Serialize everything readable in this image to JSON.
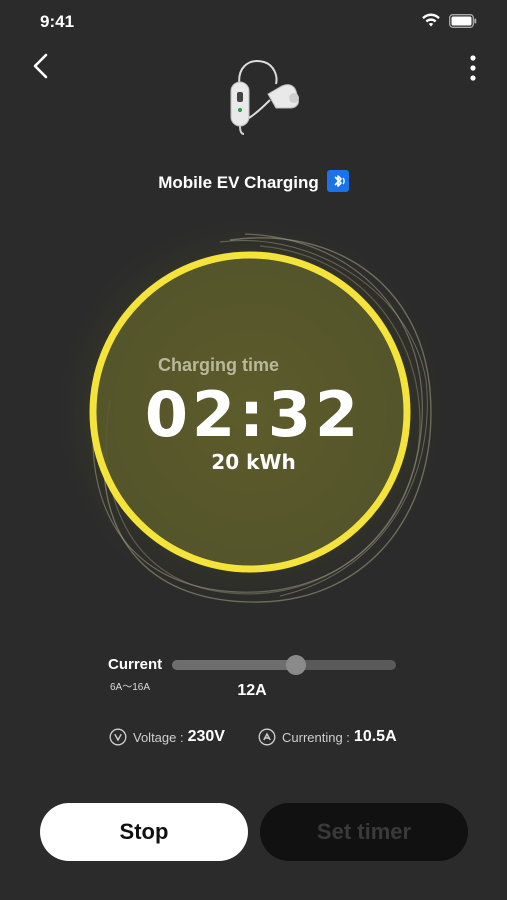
{
  "status_bar": {
    "time": "9:41"
  },
  "header": {
    "device_name": "Mobile EV Charging"
  },
  "charging": {
    "label": "Charging time",
    "time": "02:32",
    "energy": "20 kWh"
  },
  "current": {
    "label": "Current",
    "range": "6A～16A",
    "value": "12A",
    "min_a": 6,
    "max_a": 16,
    "current_a": 12
  },
  "stats": {
    "voltage_label": "Voltage :",
    "voltage_value": "230V",
    "currenting_label": "Currenting :",
    "currenting_value": "10.5A"
  },
  "actions": {
    "stop_label": "Stop",
    "timer_label": "Set timer"
  },
  "colors": {
    "accent": "#f4e33a",
    "ring_fill": "#5b5a2b",
    "background": "#2b2b2b"
  }
}
